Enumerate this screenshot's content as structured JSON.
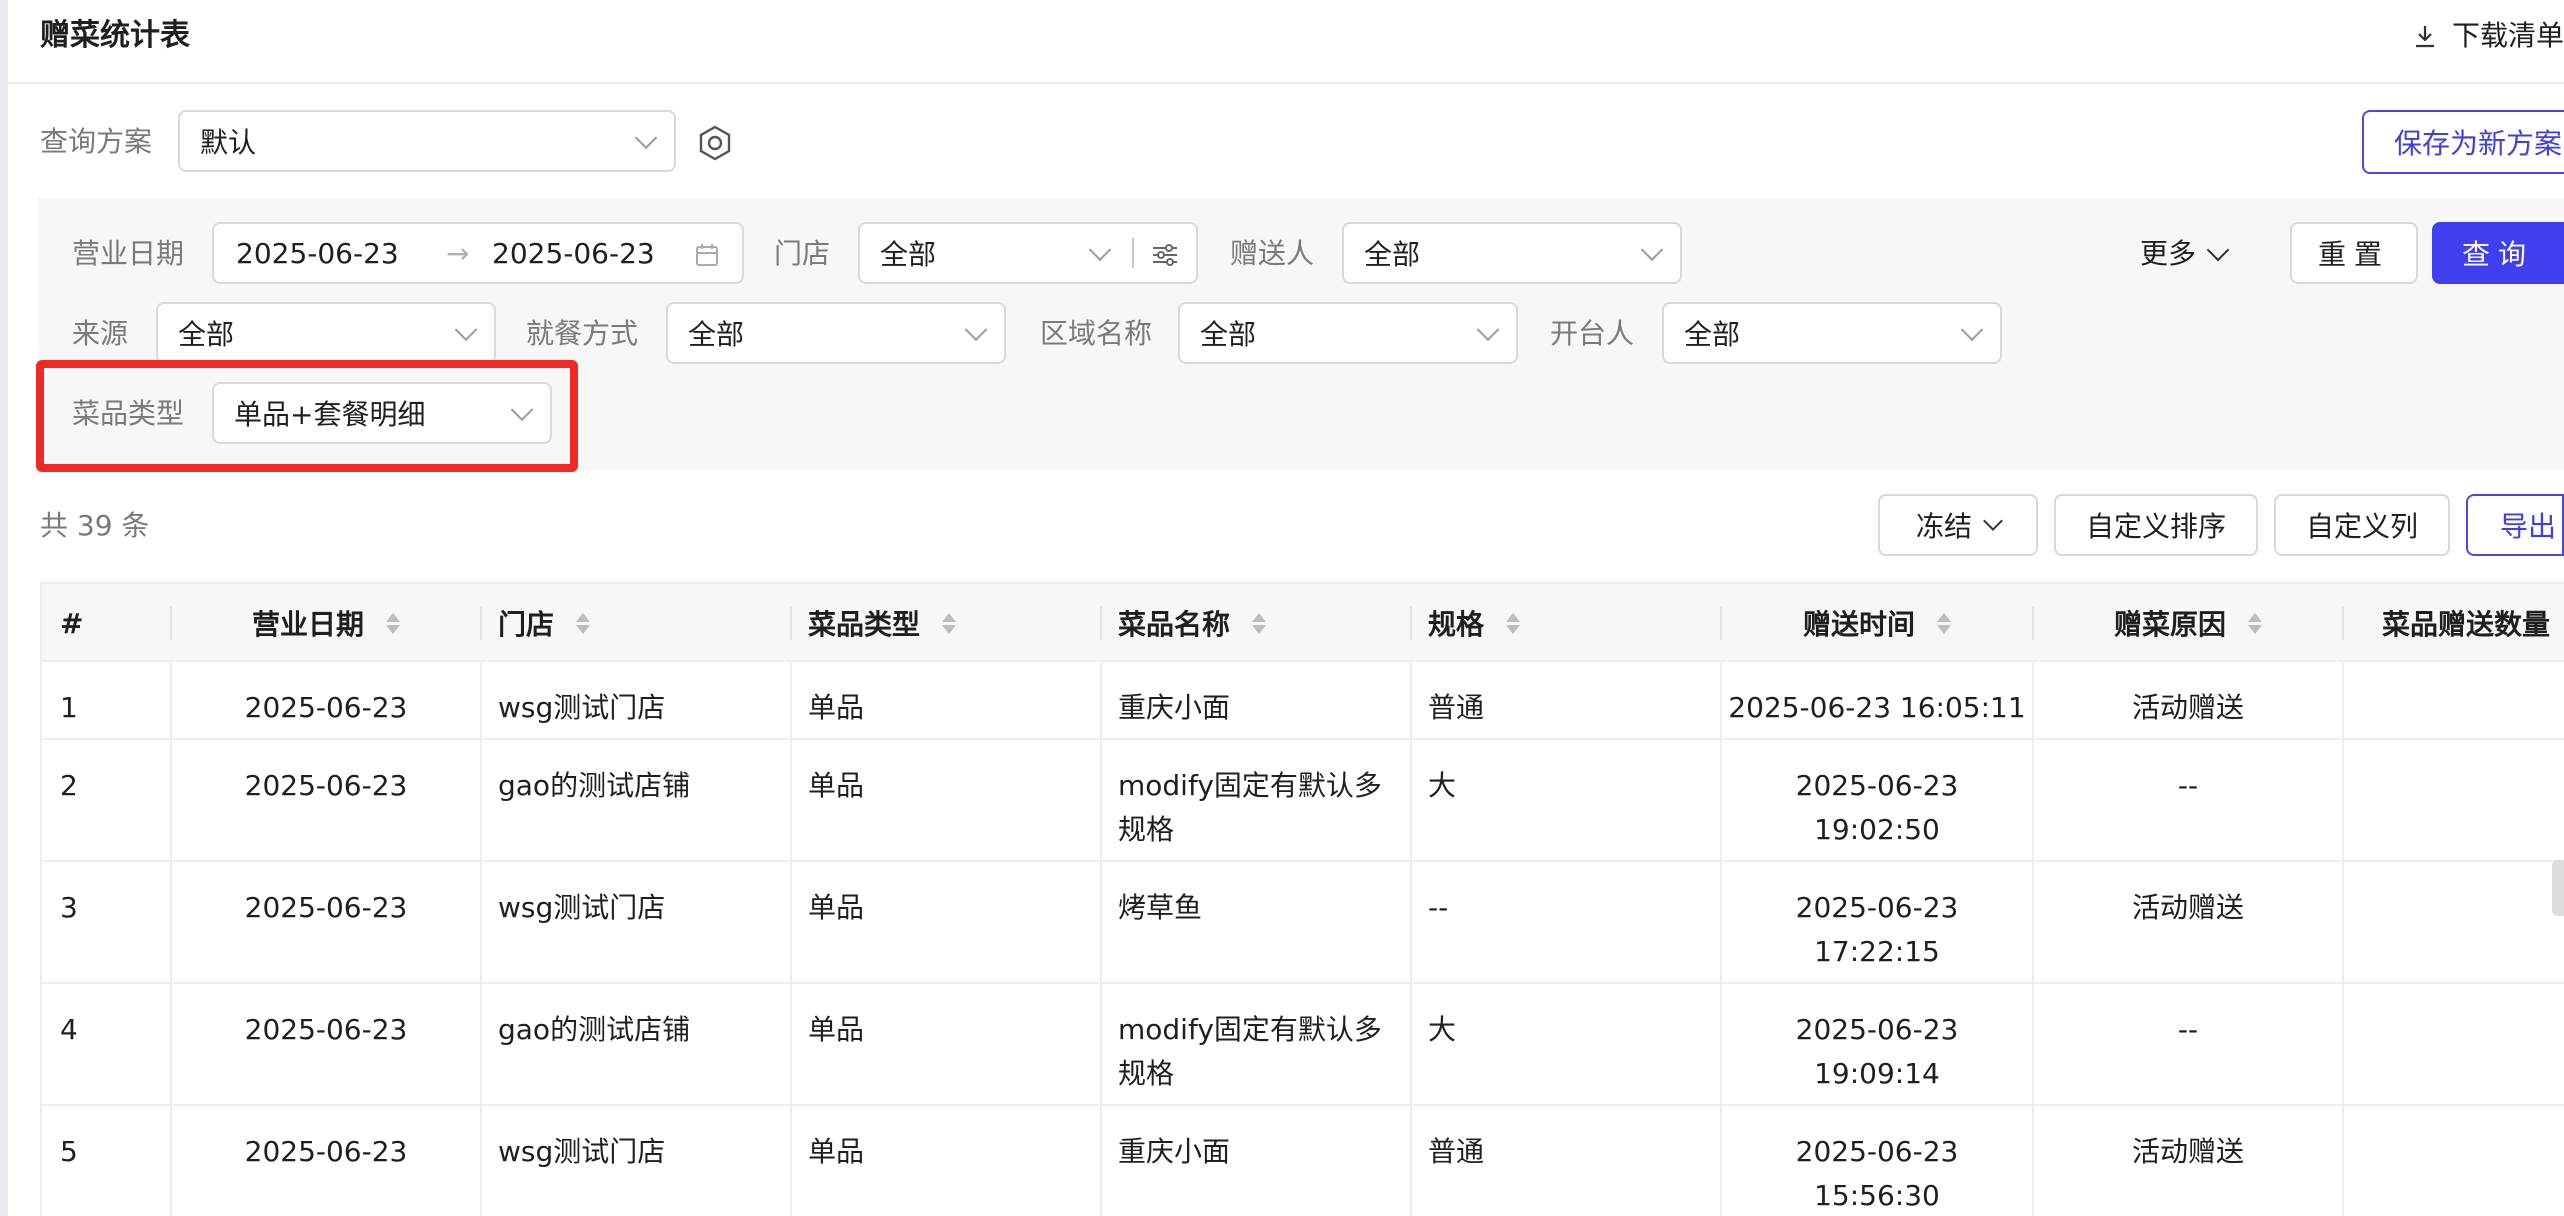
{
  "header": {
    "title": "赠菜统计表",
    "download_label": "下载清单"
  },
  "scheme": {
    "label": "查询方案",
    "value": "默认",
    "save_new_label": "保存为新方案"
  },
  "filters": {
    "business_date": {
      "label": "营业日期",
      "start": "2025-06-23",
      "arrow": "→",
      "end": "2025-06-23"
    },
    "store": {
      "label": "门店",
      "value": "全部"
    },
    "gifter": {
      "label": "赠送人",
      "value": "全部"
    },
    "source": {
      "label": "来源",
      "value": "全部"
    },
    "dining_mode": {
      "label": "就餐方式",
      "value": "全部"
    },
    "area_name": {
      "label": "区域名称",
      "value": "全部"
    },
    "opener": {
      "label": "开台人",
      "value": "全部"
    },
    "dish_type": {
      "label": "菜品类型",
      "value": "单品+套餐明细"
    },
    "more_label": "更多",
    "reset_label": "重置",
    "query_label": "查询"
  },
  "summary": {
    "total_text": "共 39 条"
  },
  "toolbar": {
    "freeze_label": "冻结",
    "custom_sort_label": "自定义排序",
    "custom_columns_label": "自定义列",
    "export_label": "导出"
  },
  "table": {
    "columns": [
      "#",
      "营业日期",
      "门店",
      "菜品类型",
      "菜品名称",
      "规格",
      "赠送时间",
      "赠菜原因",
      "菜品赠送数量"
    ],
    "rows": [
      {
        "idx": "1",
        "date": "2025-06-23",
        "store": "wsg测试门店",
        "type": "单品",
        "name": "重庆小面",
        "name2": "",
        "spec": "普通",
        "time": "2025-06-23 16:05:11",
        "time2": "",
        "reason": "活动赠送"
      },
      {
        "idx": "2",
        "date": "2025-06-23",
        "store": "gao的测试店铺",
        "type": "单品",
        "name": "modify固定有默认多",
        "name2": "规格",
        "spec": "大",
        "time": "2025-06-23",
        "time2": "19:02:50",
        "reason": "--"
      },
      {
        "idx": "3",
        "date": "2025-06-23",
        "store": "wsg测试门店",
        "type": "单品",
        "name": "烤草鱼",
        "name2": "",
        "spec": "--",
        "time": "2025-06-23",
        "time2": "17:22:15",
        "reason": "活动赠送"
      },
      {
        "idx": "4",
        "date": "2025-06-23",
        "store": "gao的测试店铺",
        "type": "单品",
        "name": "modify固定有默认多",
        "name2": "规格",
        "spec": "大",
        "time": "2025-06-23",
        "time2": "19:09:14",
        "reason": "--"
      },
      {
        "idx": "5",
        "date": "2025-06-23",
        "store": "wsg测试门店",
        "type": "单品",
        "name": "重庆小面",
        "name2": "",
        "spec": "普通",
        "time": "2025-06-23",
        "time2": "15:56:30",
        "reason": "活动赠送"
      }
    ]
  },
  "colors": {
    "primary": "#3f3ff0",
    "highlight": "#ee2b23",
    "panel": "#f7f7f7"
  }
}
